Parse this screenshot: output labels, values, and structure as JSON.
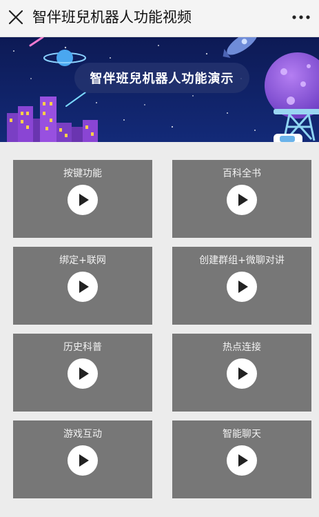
{
  "header": {
    "title": "智伴班兒机器人功能视频",
    "close_icon": "close-icon",
    "more_icon": "more-dots-icon"
  },
  "banner": {
    "title": "智伴班兒机器人功能演示"
  },
  "videos": [
    {
      "label": "按键功能",
      "icon": "play-icon"
    },
    {
      "label": "百科全书",
      "icon": "play-icon"
    },
    {
      "label": "绑定+联网",
      "icon": "play-icon"
    },
    {
      "label": "创建群组+微聊对讲",
      "icon": "play-icon"
    },
    {
      "label": "历史科普",
      "icon": "play-icon"
    },
    {
      "label": "热点连接",
      "icon": "play-icon"
    },
    {
      "label": "游戏互动",
      "icon": "play-icon"
    },
    {
      "label": "智能聊天",
      "icon": "play-icon"
    }
  ],
  "colors": {
    "tile_bg": "#777777",
    "page_bg": "#ececec",
    "banner_bg": "#0f1b5a"
  }
}
